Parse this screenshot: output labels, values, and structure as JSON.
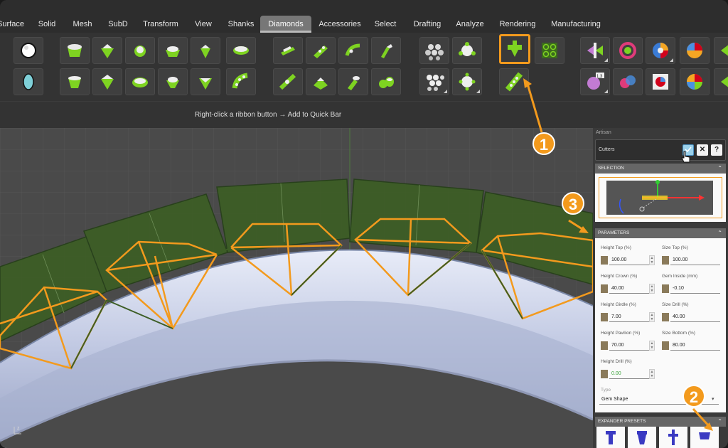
{
  "tabs": [
    "Surface",
    "Solid",
    "Mesh",
    "SubD",
    "Transform",
    "View",
    "Shanks",
    "Diamonds",
    "Accessories",
    "Select",
    "Drafting",
    "Analyze",
    "Rendering",
    "Manufacturing"
  ],
  "active_tab": "Diamonds",
  "quickbar_hint": "Right-click a ribbon button → Add to Quick Bar",
  "panel": {
    "title": "Artisan",
    "cutters_label": "Cutters",
    "close_label": "✕",
    "help_label": "?",
    "selection_header": "SELECTION",
    "parameters_header": "PARAMETERS",
    "expander_header": "EXPANDER PRESETS",
    "type_label": "Type",
    "type_value": "Gem Shape",
    "params": [
      {
        "label": "Height Top (%)",
        "value": "100.00"
      },
      {
        "label": "Size Top (%)",
        "value": "100.00"
      },
      {
        "label": "Height Crown (%)",
        "value": "40.00"
      },
      {
        "label": "Gem Inside (mm)",
        "value": "-0.10"
      },
      {
        "label": "Height Girdle (%)",
        "value": "7.00"
      },
      {
        "label": "Size Drill (%)",
        "value": "40.00"
      },
      {
        "label": "Height Pavilion (%)",
        "value": "70.00"
      },
      {
        "label": "Size Bottom (%)",
        "value": "80.00"
      },
      {
        "label": "Height Drill (%)",
        "value": "0.00"
      }
    ]
  },
  "annotations": [
    "1",
    "2",
    "3"
  ],
  "colors": {
    "accent": "#f39a1d",
    "gem_green": "#7ed321",
    "cutter_green": "#3d5e26",
    "ring": "#c5cde8"
  }
}
